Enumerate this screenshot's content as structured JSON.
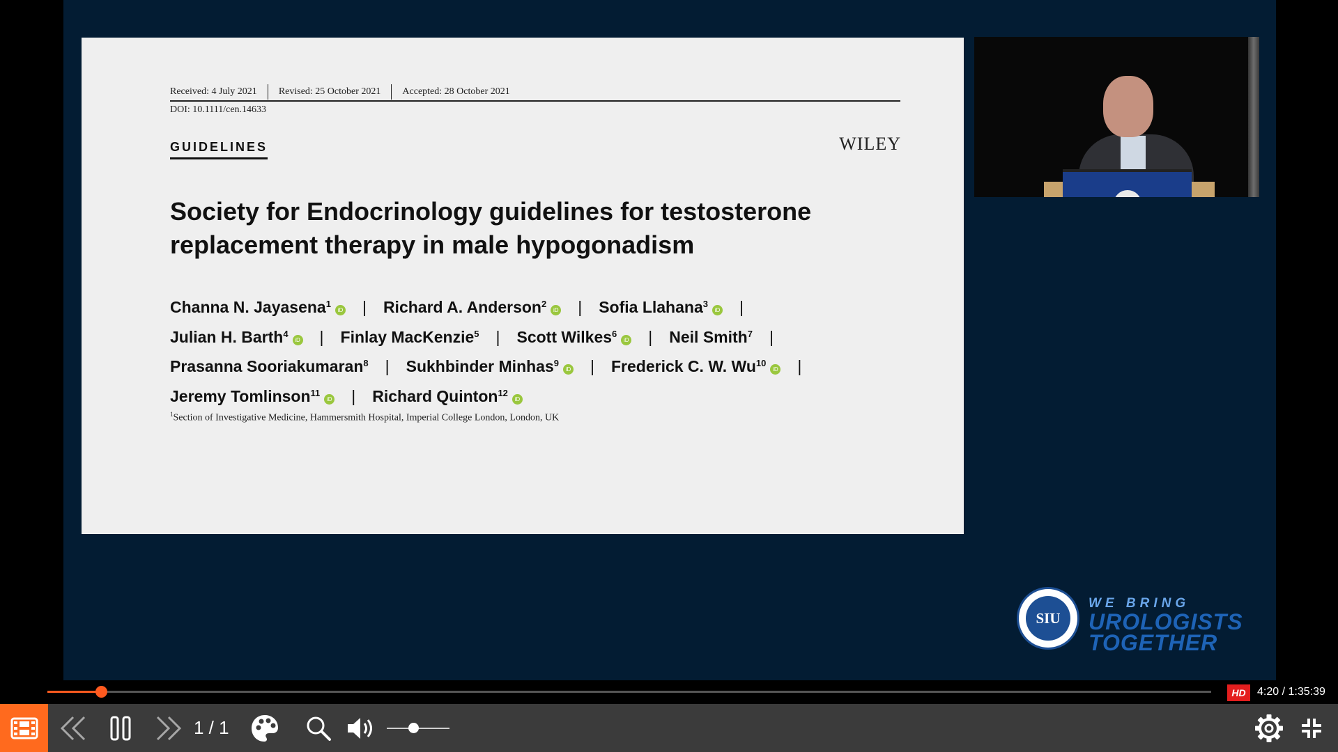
{
  "slide": {
    "received": "Received: 4 July 2021",
    "revised": "Revised: 25 October 2021",
    "accepted": "Accepted: 28 October 2021",
    "doi": "DOI: 10.1111/cen.14633",
    "section": "GUIDELINES",
    "publisher": "WILEY",
    "title_line1": "Society for Endocrinology guidelines for testosterone",
    "title_line2": "replacement therapy in male hypogonadism",
    "separator": "|",
    "orcid_symbol": "iD",
    "authors": [
      {
        "name": "Channa N. Jayasena",
        "sup": "1"
      },
      {
        "name": "Richard A. Anderson",
        "sup": "2"
      },
      {
        "name": "Sofia Llahana",
        "sup": "3"
      },
      {
        "name": "Julian H. Barth",
        "sup": "4"
      },
      {
        "name": "Finlay MacKenzie",
        "sup": "5"
      },
      {
        "name": "Scott Wilkes",
        "sup": "6"
      },
      {
        "name": "Neil Smith",
        "sup": "7"
      },
      {
        "name": "Prasanna Sooriakumaran",
        "sup": "8"
      },
      {
        "name": "Sukhbinder Minhas",
        "sup": "9"
      },
      {
        "name": "Frederick C. W. Wu",
        "sup": "10"
      },
      {
        "name": "Jeremy Tomlinson",
        "sup": "11"
      },
      {
        "name": "Richard Quinton",
        "sup": "12"
      }
    ],
    "affiliation_sup": "1",
    "affiliation": "Section of Investigative Medicine, Hammersmith Hospital, Imperial College London, London, UK"
  },
  "branding": {
    "logo_text": "SIU",
    "tagline_1": "WE BRING",
    "tagline_2": "UROLOGISTS",
    "tagline_3": "TOGETHER",
    "accent": "#1e63b6"
  },
  "player": {
    "progress_fraction": 0.046,
    "volume_fraction": 0.42,
    "quality_badge": "HD",
    "time": "4:20 / 1:35:39",
    "page_count": "1 / 1",
    "accent_color": "#ff6a1e",
    "icons": [
      "chapters-icon",
      "previous-icon",
      "pause-icon",
      "next-icon",
      "theme-palette-icon",
      "zoom-icon",
      "volume-icon",
      "settings-icon",
      "exit-fullscreen-icon"
    ]
  }
}
